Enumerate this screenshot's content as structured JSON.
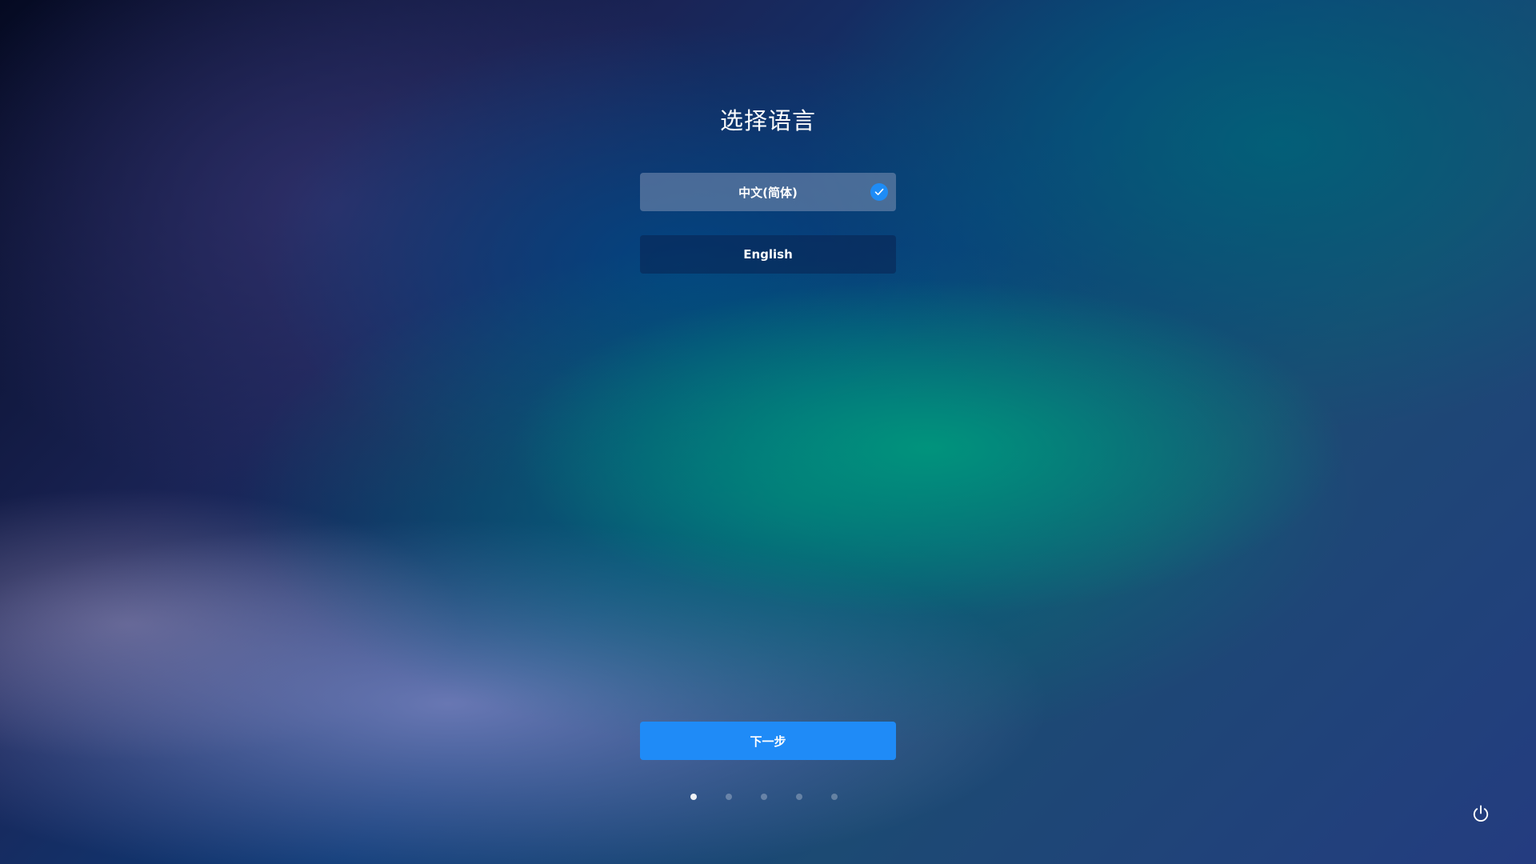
{
  "header": {
    "title": "选择语言"
  },
  "languages": [
    {
      "label": "中文(简体)",
      "selected": true
    },
    {
      "label": "English",
      "selected": false
    }
  ],
  "next_button": {
    "label": "下一步"
  },
  "steps": {
    "total": 5,
    "current": 1
  },
  "icons": {
    "check": "check-icon",
    "power": "power-icon"
  },
  "colors": {
    "accent": "#1f8bf7",
    "check": "#1e8cf6"
  }
}
